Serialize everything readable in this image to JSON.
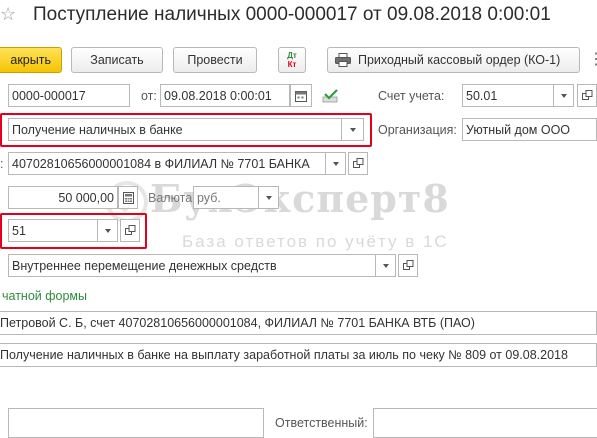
{
  "window": {
    "title": "Поступление наличных 0000-000017 от 09.08.2018 0:00:01"
  },
  "toolbar": {
    "close_label": "акрыть",
    "save_label": "Записать",
    "post_label": "Провести",
    "dt_kt_top": "Дт",
    "dt_kt_bottom": "Кт",
    "print_label": "Приходный кассовый ордер (КО-1)"
  },
  "header": {
    "number": "0000-000017",
    "date_label": "от:",
    "date_value": "09.08.2018  0:00:01",
    "account_label": "Счет учета:",
    "account_value": "50.01"
  },
  "operation": {
    "value": "Получение наличных в банке"
  },
  "organization": {
    "label": "Организация:",
    "value": "Уютный дом ООО"
  },
  "bank_account": {
    "label": ":",
    "value": "40702810656000001084 в ФИЛИАЛ № 7701 БАНКА"
  },
  "amount": {
    "value": "50 000,00",
    "currency_label": "Валюта:",
    "currency_value": "руб."
  },
  "corr_account": {
    "value": "51"
  },
  "cash_flow": {
    "value": "Внутреннее перемещение денежных средств"
  },
  "print_form_link": "чатной формы",
  "from_whom": {
    "value": "Петровой С. Б, счет 40702810656000001084, ФИЛИАЛ № 7701 БАНКА ВТБ (ПАО)"
  },
  "basis": {
    "value": "Получение наличных в банке на выплату заработной платы за июль по чеку № 809 от 09.08.2018"
  },
  "responsible": {
    "label": "Ответственный:"
  },
  "watermark": {
    "brand": "БухЭксперт8",
    "tagline": "База ответов по учёту в 1С"
  },
  "colors": {
    "highlight": "#e2001a",
    "primary_button": "#f5c400",
    "link": "#2e8b3d"
  }
}
